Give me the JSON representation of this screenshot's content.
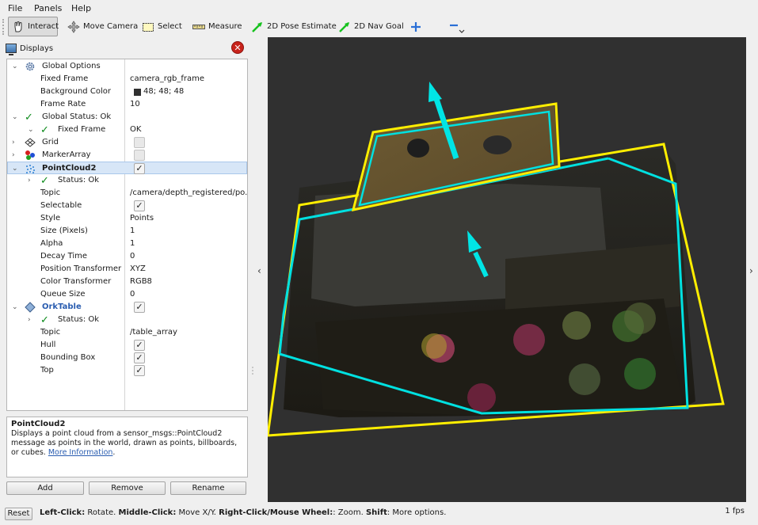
{
  "menu": {
    "file": "File",
    "panels": "Panels",
    "help": "Help"
  },
  "toolbar": {
    "interact": "Interact",
    "move_camera": "Move Camera",
    "select": "Select",
    "measure": "Measure",
    "pose_estimate": "2D Pose Estimate",
    "nav_goal": "2D Nav Goal"
  },
  "displays": {
    "title": "Displays",
    "rows": [
      {
        "name": "Global Options",
        "value": ""
      },
      {
        "name": "Fixed Frame",
        "value": "camera_rgb_frame"
      },
      {
        "name": "Background Color",
        "value": "48; 48; 48"
      },
      {
        "name": "Frame Rate",
        "value": "10"
      },
      {
        "name": "Global Status: Ok",
        "value": ""
      },
      {
        "name": "Fixed Frame",
        "value": "OK"
      },
      {
        "name": "Grid",
        "value": ""
      },
      {
        "name": "MarkerArray",
        "value": ""
      },
      {
        "name": "PointCloud2",
        "value": ""
      },
      {
        "name": "Status: Ok",
        "value": ""
      },
      {
        "name": "Topic",
        "value": "/camera/depth_registered/po..."
      },
      {
        "name": "Selectable",
        "value": ""
      },
      {
        "name": "Style",
        "value": "Points"
      },
      {
        "name": "Size (Pixels)",
        "value": "1"
      },
      {
        "name": "Alpha",
        "value": "1"
      },
      {
        "name": "Decay Time",
        "value": "0"
      },
      {
        "name": "Position Transformer",
        "value": "XYZ"
      },
      {
        "name": "Color Transformer",
        "value": "RGB8"
      },
      {
        "name": "Queue Size",
        "value": "0"
      },
      {
        "name": "OrkTable",
        "value": ""
      },
      {
        "name": "Status: Ok",
        "value": ""
      },
      {
        "name": "Topic",
        "value": "/table_array"
      },
      {
        "name": "Hull",
        "value": ""
      },
      {
        "name": "Bounding Box",
        "value": ""
      },
      {
        "name": "Top",
        "value": ""
      }
    ]
  },
  "description": {
    "title": "PointCloud2",
    "text": "Displays a point cloud from a sensor_msgs::PointCloud2 message as points in the world, drawn as points, billboards, or cubes.",
    "link": "More Information",
    "suffix": "."
  },
  "buttons": {
    "add": "Add",
    "remove": "Remove",
    "rename": "Rename"
  },
  "status": {
    "reset": "Reset",
    "lc": "Left-Click:",
    "lc_t": " Rotate. ",
    "mc": "Middle-Click:",
    "mc_t": " Move X/Y. ",
    "rc": "Right-Click/Mouse Wheel:",
    "rc_t": ": Zoom. ",
    "sh": "Shift",
    "sh_t": ": More options.",
    "fps": "1 fps"
  },
  "colors": {
    "background": "#303030",
    "hull_outline": "#ffee00",
    "normal_arrow": "#00e5e5"
  }
}
